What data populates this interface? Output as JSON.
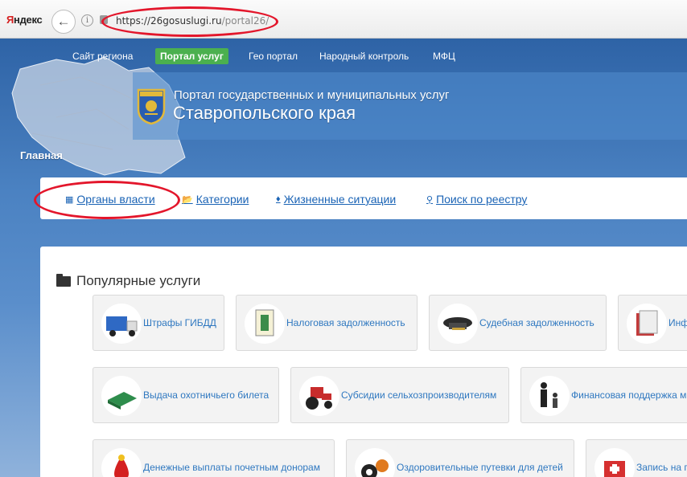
{
  "browser": {
    "logo_red": "Я",
    "logo_rest": "ндекс",
    "url_main": "https://26gosuslugi.ru",
    "url_path": "/portal26/"
  },
  "topnav": {
    "items": [
      "Сайт региона",
      "Портал услуг",
      "Гео портал",
      "Народный контроль",
      "МФЦ"
    ]
  },
  "header": {
    "title_line1": "Портал государственных и муниципальных услуг",
    "title_line2": "Ставропольского края"
  },
  "breadcrumb": "Главная",
  "tabs": [
    {
      "label": "Органы власти",
      "icon": "building-icon"
    },
    {
      "label": "Категории",
      "icon": "folder-open-icon"
    },
    {
      "label": "Жизненные ситуации",
      "icon": "drop-icon"
    },
    {
      "label": "Поиск по реестру",
      "icon": "search-icon"
    }
  ],
  "popular": {
    "title": "Популярные услуги",
    "cards": [
      {
        "label": "Штрафы ГИБДД",
        "icon": "truck-icon"
      },
      {
        "label": "Налоговая задолженность",
        "icon": "document-icon"
      },
      {
        "label": "Судебная задолженность",
        "icon": "cap-icon"
      },
      {
        "label": "Инф",
        "icon": "papers-icon"
      },
      {
        "label": "Выдача охотничьего билета",
        "icon": "book-icon"
      },
      {
        "label": "Субсидии сельхозпроизводителям",
        "icon": "tractor-icon"
      },
      {
        "label": "Финансовая поддержка м",
        "icon": "people-icon"
      },
      {
        "label": "Денежные выплаты почетным донорам",
        "icon": "blood-drop-icon"
      },
      {
        "label": "Оздоровительные путевки для детей",
        "icon": "balls-icon"
      },
      {
        "label": "Запись на п",
        "icon": "medical-icon"
      }
    ]
  },
  "colors": {
    "accent_red": "#e3162b",
    "link_blue": "#1a63b5",
    "active_green": "#4bb04f"
  }
}
